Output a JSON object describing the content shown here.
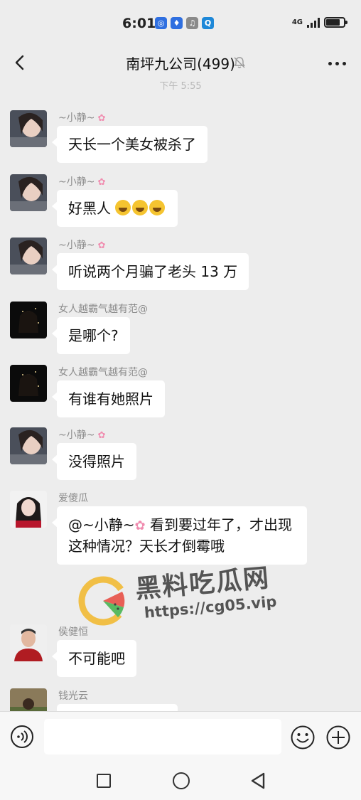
{
  "status": {
    "time": "6:01",
    "network": "4G",
    "battery_level": 0.8,
    "app_icons": [
      "baidu-icon",
      "tiktok-icon",
      "music-icon",
      "qq-browser-icon"
    ]
  },
  "header": {
    "title": "南坪九公司(499)"
  },
  "chat": {
    "time_divider": "下午 5:55",
    "messages": [
      {
        "sender": "~小静~",
        "text": "天长一个美女被杀了"
      },
      {
        "sender": "~小静~",
        "text": "好黑人",
        "emoji_count": 3
      },
      {
        "sender": "~小静~",
        "text": "听说两个月骗了老头 13 万"
      },
      {
        "sender": "女人越霸气越有范@",
        "text": "是哪个?"
      },
      {
        "sender": "女人越霸气越有范@",
        "text": "有谁有她照片"
      },
      {
        "sender": "~小静~",
        "text": "没得照片"
      },
      {
        "sender": "爱傻瓜",
        "mention": "@~小静~",
        "text_after": " 看到要过年了，才出现这种情况？天长才倒霉哦"
      },
      {
        "sender": "侯健恒",
        "text": "不可能吧"
      },
      {
        "sender": "钱光云",
        "text": ""
      }
    ]
  },
  "watermark": {
    "title": "黑料吃瓜网",
    "url": "https://cg05.vip"
  },
  "input": {
    "placeholder": ""
  }
}
